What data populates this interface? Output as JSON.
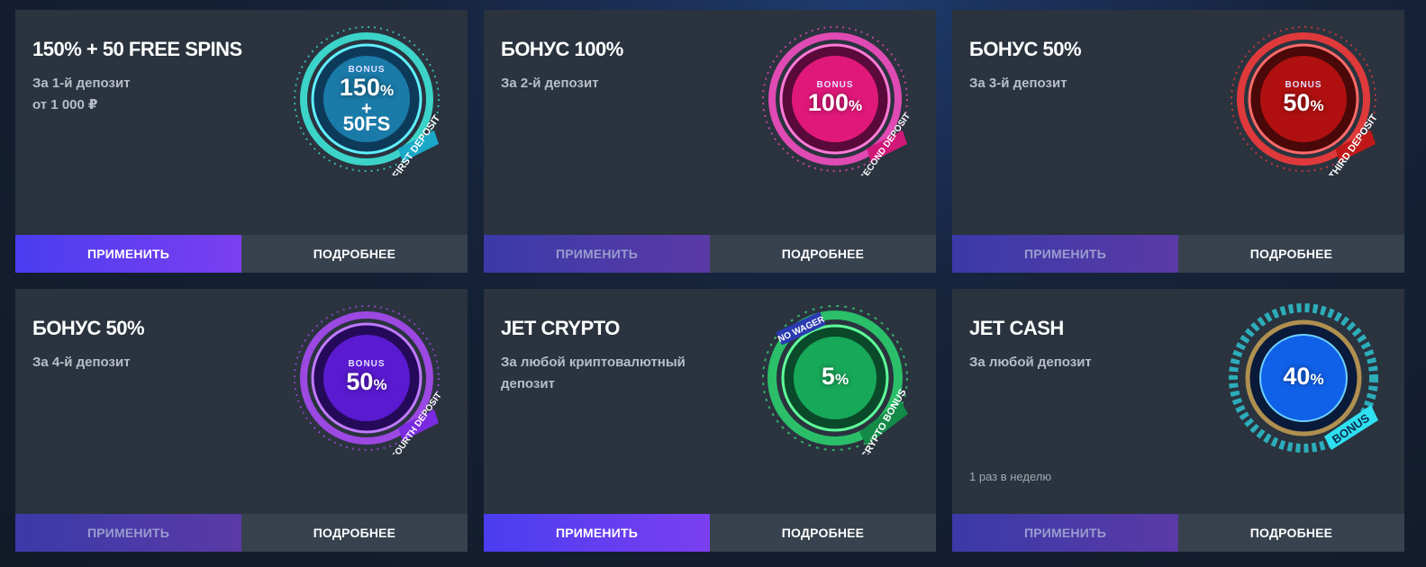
{
  "cards": [
    {
      "title": "150% + 50 FREE SPINS",
      "desc": "За 1-й депозит\nот 1 000 ₽",
      "note": "",
      "apply": "ПРИМЕНИТЬ",
      "more": "ПОДРОБНЕЕ",
      "apply_active": true,
      "badge": {
        "top": "BONUS",
        "value": "150",
        "suffix": "%",
        "plus": "+",
        "extra": "50FS",
        "ribbon": "FIRST DEPOSIT",
        "color": "#20b8d8",
        "glow": "#3ff0e0"
      }
    },
    {
      "title": "БОНУС 100%",
      "desc": "За 2-й депозит",
      "note": "",
      "apply": "ПРИМЕНИТЬ",
      "more": "ПОДРОБНЕЕ",
      "apply_active": false,
      "badge": {
        "top": "BONUS",
        "value": "100",
        "suffix": "%",
        "ribbon": "SECOND DEPOSIT",
        "color": "#e0187a",
        "glow": "#ff4fc8"
      }
    },
    {
      "title": "БОНУС 50%",
      "desc": "За 3-й депозит",
      "note": "",
      "apply": "ПРИМЕНИТЬ",
      "more": "ПОДРОБНЕЕ",
      "apply_active": false,
      "badge": {
        "top": "BONUS",
        "value": "50",
        "suffix": "%",
        "ribbon": "THIRD DEPOSIT",
        "color": "#c01818",
        "glow": "#ff3b3b"
      }
    },
    {
      "title": "БОНУС 50%",
      "desc": "За 4-й депозит",
      "note": "",
      "apply": "ПРИМЕНИТЬ",
      "more": "ПОДРОБНЕЕ",
      "apply_active": false,
      "badge": {
        "top": "BONUS",
        "value": "50",
        "suffix": "%",
        "ribbon": "FOURTH DEPOSIT",
        "color": "#5a1ad0",
        "glow": "#b04cff"
      }
    },
    {
      "title": "JET CRYPTO",
      "desc": "За любой криптовалютный депозит",
      "note": "",
      "apply": "ПРИМЕНИТЬ",
      "more": "ПОДРОБНЕЕ",
      "apply_active": true,
      "badge": {
        "top": "NO WAGER",
        "value": "5",
        "suffix": "%",
        "ribbon": "CRYPTO BONUS",
        "color": "#18a85a",
        "glow": "#3fff8a"
      }
    },
    {
      "title": "JET CASH",
      "desc": "За любой депозит",
      "note": "1 раз в неделю",
      "apply": "ПРИМЕНИТЬ",
      "more": "ПОДРОБНЕЕ",
      "apply_active": false,
      "badge": {
        "top": "",
        "value": "40",
        "suffix": "%",
        "ribbon": "BONUS",
        "color": "#1060e8",
        "glow": "#2fe0f0"
      }
    }
  ]
}
